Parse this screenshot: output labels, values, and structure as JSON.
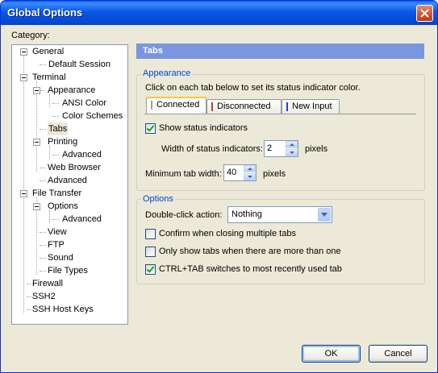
{
  "window": {
    "title": "Global Options"
  },
  "category_label": "Category:",
  "tree": [
    {
      "label": "General"
    },
    {
      "label": "Default Session"
    },
    {
      "label": "Terminal"
    },
    {
      "label": "Appearance"
    },
    {
      "label": "ANSI Color"
    },
    {
      "label": "Color Schemes"
    },
    {
      "label": "Tabs",
      "selected": true
    },
    {
      "label": "Printing"
    },
    {
      "label": "Advanced"
    },
    {
      "label": "Web Browser"
    },
    {
      "label": "Advanced"
    },
    {
      "label": "File Transfer"
    },
    {
      "label": "Options"
    },
    {
      "label": "Advanced"
    },
    {
      "label": "View"
    },
    {
      "label": "FTP"
    },
    {
      "label": "Sound"
    },
    {
      "label": "File Types"
    },
    {
      "label": "Firewall"
    },
    {
      "label": "SSH2"
    },
    {
      "label": "SSH Host Keys"
    }
  ],
  "panel": {
    "title": "Tabs",
    "appearance": {
      "title": "Appearance",
      "instruction": "Click on each tab below to set its status indicator color.",
      "tabs": [
        {
          "label": "Connected",
          "color": "#a0a0a0",
          "active": true
        },
        {
          "label": "Disconnected",
          "color": "#d63a1c"
        },
        {
          "label": "New Input",
          "color": "#1c3ad6"
        }
      ],
      "show_status_indicators": {
        "label": "Show status indicators",
        "checked": true
      },
      "width_of_indicators": {
        "label": "Width of status indicators:",
        "value": "2",
        "unit": "pixels"
      },
      "min_tab_width": {
        "label": "Minimum tab width:",
        "value": "40",
        "unit": "pixels"
      }
    },
    "options": {
      "title": "Options",
      "double_click": {
        "label": "Double-click action:",
        "value": "Nothing"
      },
      "confirm_close": {
        "label": "Confirm when closing multiple tabs",
        "checked": false
      },
      "only_show_tabs": {
        "label": "Only show tabs when there are more than one",
        "checked": false
      },
      "ctrl_tab": {
        "label": "CTRL+TAB switches to most recently used tab",
        "checked": true
      }
    }
  },
  "buttons": {
    "ok": "OK",
    "cancel": "Cancel"
  },
  "colors": {
    "title_bar": "#0a5ce8",
    "panel_header": "#7a96df",
    "group_title": "#0046d5"
  }
}
